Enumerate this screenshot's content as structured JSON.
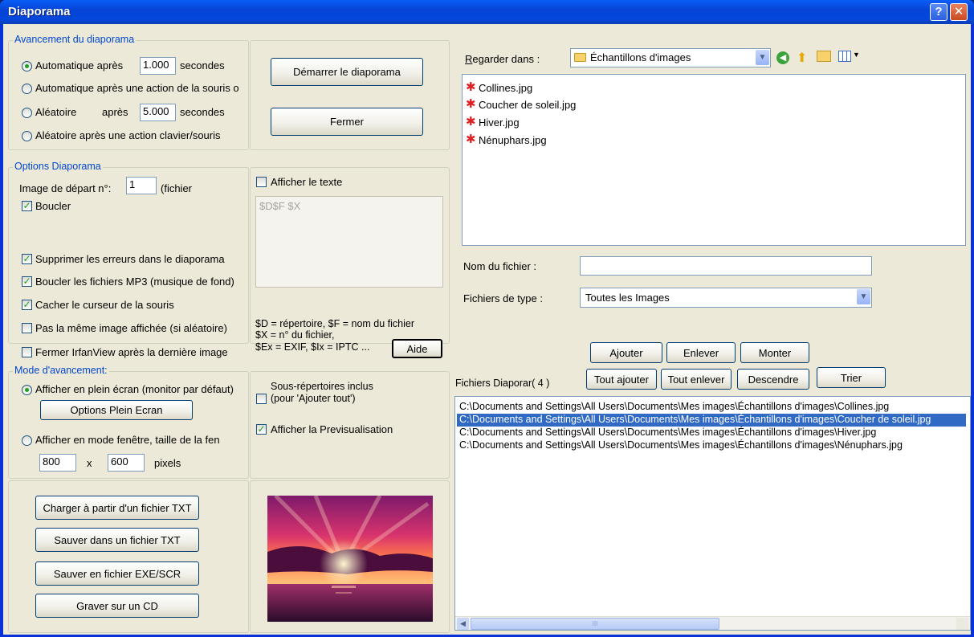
{
  "window": {
    "title": "Diaporama",
    "help_glyph": "?",
    "close_glyph": "✕"
  },
  "avancement": {
    "label": "Avancement du diaporama",
    "opt1_pre": "Automatique après",
    "opt1_value": "1.000",
    "opt1_post": "secondes",
    "opt2": "Automatique après une action de la souris o",
    "opt3_pre": "Aléatoire",
    "opt3_mid": "après",
    "opt3_value": "5.000",
    "opt3_post": "secondes",
    "opt4": "Aléatoire après une action clavier/souris",
    "selected": "opt1"
  },
  "buttons_top": {
    "start": "Démarrer le diaporama",
    "close": "Fermer"
  },
  "options": {
    "label": "Options Diaporama",
    "start_image_label": "Image de départ n°:",
    "start_image_value": "1",
    "start_image_post": "(fichier",
    "loop": "Boucler",
    "suppress_errors": "Supprimer les erreurs dans le diaporama",
    "loop_mp3": "Boucler les fichiers MP3 (musique de fond)",
    "hide_cursor": "Cacher le curseur de la souris",
    "no_same_image": "Pas la même image affichée (si aléatoire)",
    "close_irfan": "Fermer IrfanView après la dernière image",
    "show_text": "Afficher le texte",
    "text_value": "$D$F $X",
    "help_line1": "$D = répertoire, $F = nom du fichier",
    "help_line2": "$X = n° du fichier,",
    "help_line3": "$Ex = EXIF, $Ix = IPTC ...",
    "help_button": "Aide"
  },
  "mode": {
    "label": "Mode d'avancement:",
    "fullscreen": "Afficher en plein écran (monitor par défaut)",
    "fullscreen_options": "Options Plein Ecran",
    "window_mode": "Afficher en mode fenêtre, taille de la fen",
    "width": "800",
    "x": "x",
    "height": "600",
    "unit": "pixels",
    "subdirs_line1": "Sous-répertoires inclus",
    "subdirs_line2": "(pour 'Ajouter tout')",
    "preview": "Afficher la Previsualisation"
  },
  "bottom_buttons": {
    "load_txt": "Charger à partir d'un fichier TXT",
    "save_txt": "Sauver dans  un fichier TXT",
    "save_exe": "Sauver en  fichier EXE/SCR",
    "burn_cd": "Graver sur un CD"
  },
  "browser": {
    "look_in_label": "Regarder dans :",
    "folder": "Échantillons d'images",
    "files": [
      "Collines.jpg",
      "Coucher de soleil.jpg",
      "Hiver.jpg",
      "Nénuphars.jpg"
    ],
    "filename_label": "Nom du fichier :",
    "filename_value": "",
    "filetype_label": "Fichiers de type :",
    "filetype_value": "Toutes les Images"
  },
  "list_buttons": {
    "add": "Ajouter",
    "remove": "Enlever",
    "up": "Monter",
    "add_all": "Tout  ajouter",
    "remove_all": "Tout enlever",
    "down": "Descendre",
    "sort": "Trier"
  },
  "slideshow": {
    "label": "Fichiers Diaporar( 4 )",
    "items": [
      "C:\\Documents and Settings\\All Users\\Documents\\Mes images\\Échantillons d'images\\Collines.jpg",
      "C:\\Documents and Settings\\All Users\\Documents\\Mes images\\Échantillons d'images\\Coucher de soleil.jpg",
      "C:\\Documents and Settings\\All Users\\Documents\\Mes images\\Échantillons d'images\\Hiver.jpg",
      "C:\\Documents and Settings\\All Users\\Documents\\Mes images\\Échantillons d'images\\Nénuphars.jpg"
    ],
    "selected_index": 1,
    "scroll_thumb_glyph": "III"
  }
}
